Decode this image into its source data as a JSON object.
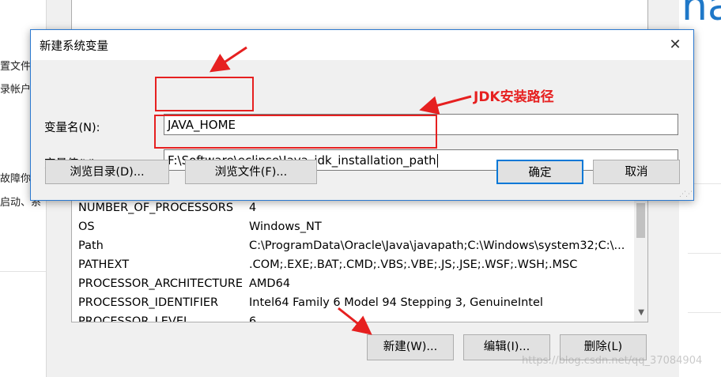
{
  "background_window": {
    "left_texts": [
      "置文件",
      "录帐户",
      "故障你",
      "启动、系"
    ],
    "env_list": [
      {
        "name": "NUMBER_OF_PROCESSORS",
        "value": "4"
      },
      {
        "name": "OS",
        "value": "Windows_NT"
      },
      {
        "name": "Path",
        "value": "C:\\ProgramData\\Oracle\\Java\\javapath;C:\\Windows\\system32;C:\\..."
      },
      {
        "name": "PATHEXT",
        "value": ".COM;.EXE;.BAT;.CMD;.VBS;.VBE;.JS;.JSE;.WSF;.WSH;.MSC"
      },
      {
        "name": "PROCESSOR_ARCHITECTURE",
        "value": "AMD64"
      },
      {
        "name": "PROCESSOR_IDENTIFIER",
        "value": "Intel64 Family 6 Model 94 Stepping 3, GenuineIntel"
      },
      {
        "name": "PROCESSOR_LEVEL",
        "value": "6"
      }
    ],
    "buttons": {
      "new": "新建(W)...",
      "edit": "编辑(I)...",
      "delete": "删除(L)"
    },
    "right_logo_text": "nac"
  },
  "dialog": {
    "title": "新建系统变量",
    "close_glyph": "✕",
    "name_label": "变量名(N):",
    "name_value": "JAVA_HOME",
    "value_label": "变量值(V):",
    "value_value": "F:\\Software\\eclipse\\Java_jdk_installation_path",
    "browse_dir": "浏览目录(D)...",
    "browse_file": "浏览文件(F)...",
    "ok": "确定",
    "cancel": "取消"
  },
  "annotation": {
    "text": "JDK安装路径",
    "color": "#e62020"
  },
  "watermark": "https://blog.csdn.net/qq_37084904",
  "colors": {
    "accent": "#0078d7",
    "dialog_border": "#2b79d0",
    "annotation": "#e62020"
  }
}
